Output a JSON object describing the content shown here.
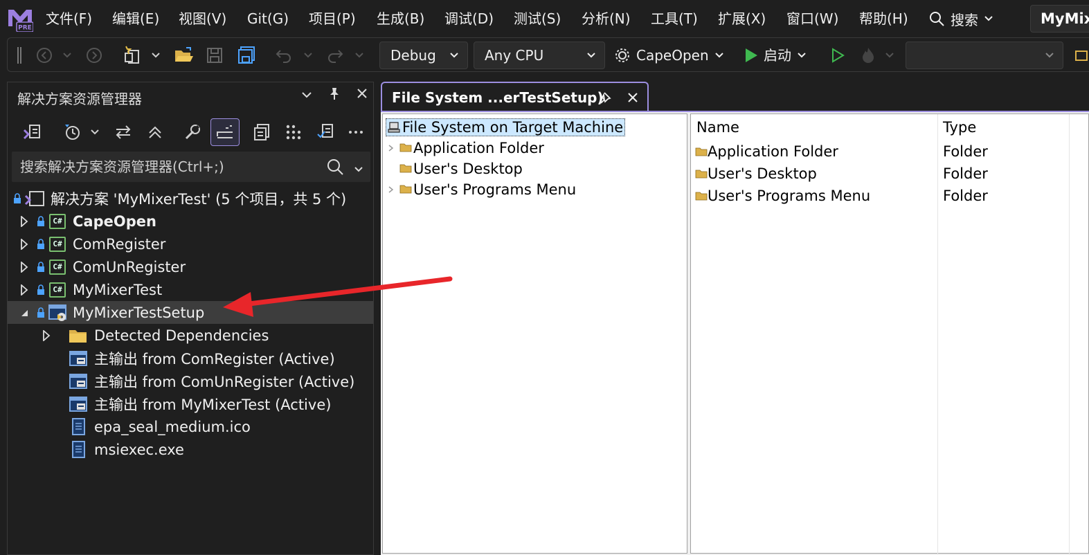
{
  "menu": {
    "logo_badge": "PRE",
    "items": [
      "文件(F)",
      "编辑(E)",
      "视图(V)",
      "Git(G)",
      "项目(P)",
      "生成(B)",
      "调试(D)",
      "测试(S)",
      "分析(N)",
      "工具(T)",
      "扩展(X)",
      "窗口(W)",
      "帮助(H)"
    ],
    "search_label": "搜索",
    "window_title": "MyMixerTest"
  },
  "toolbar": {
    "configuration": "Debug",
    "platform": "Any CPU",
    "startup_project": "CapeOpen",
    "start_label": "启动"
  },
  "solution_explorer": {
    "title": "解决方案资源管理器",
    "search_placeholder": "搜索解决方案资源管理器(Ctrl+;)",
    "solution_label": "解决方案 'MyMixerTest' (5 个项目，共 5 个)",
    "projects": [
      {
        "name": "CapeOpen",
        "badge": "C#"
      },
      {
        "name": "ComRegister",
        "badge": "C#"
      },
      {
        "name": "ComUnRegister",
        "badge": "C#"
      },
      {
        "name": "MyMixerTest",
        "badge": "C#"
      }
    ],
    "setup_project": "MyMixerTestSetup",
    "setup_children": [
      {
        "name": "Detected Dependencies",
        "icon": "folder-icon"
      },
      {
        "name": "主输出 from ComRegister (Active)",
        "icon": "output-icon"
      },
      {
        "name": "主输出 from ComUnRegister (Active)",
        "icon": "output-icon"
      },
      {
        "name": "主输出 from MyMixerTest (Active)",
        "icon": "output-icon"
      },
      {
        "name": "epa_seal_medium.ico",
        "icon": "file-icon"
      },
      {
        "name": "msiexec.exe",
        "icon": "file-icon"
      }
    ]
  },
  "document": {
    "tab_title": "File System ...erTestSetup)",
    "tree": {
      "root": "File System on Target Machine",
      "children": [
        "Application Folder",
        "User's Desktop",
        "User's Programs Menu"
      ]
    },
    "list": {
      "columns": [
        "Name",
        "Type"
      ],
      "rows": [
        {
          "name": "Application Folder",
          "type": "Folder"
        },
        {
          "name": "User's Desktop",
          "type": "Folder"
        },
        {
          "name": "User's Programs Menu",
          "type": "Folder"
        }
      ]
    }
  },
  "colors": {
    "accent": "#9c8ee0",
    "annotation_arrow": "#e8262a",
    "background": "#1f1f1f"
  }
}
